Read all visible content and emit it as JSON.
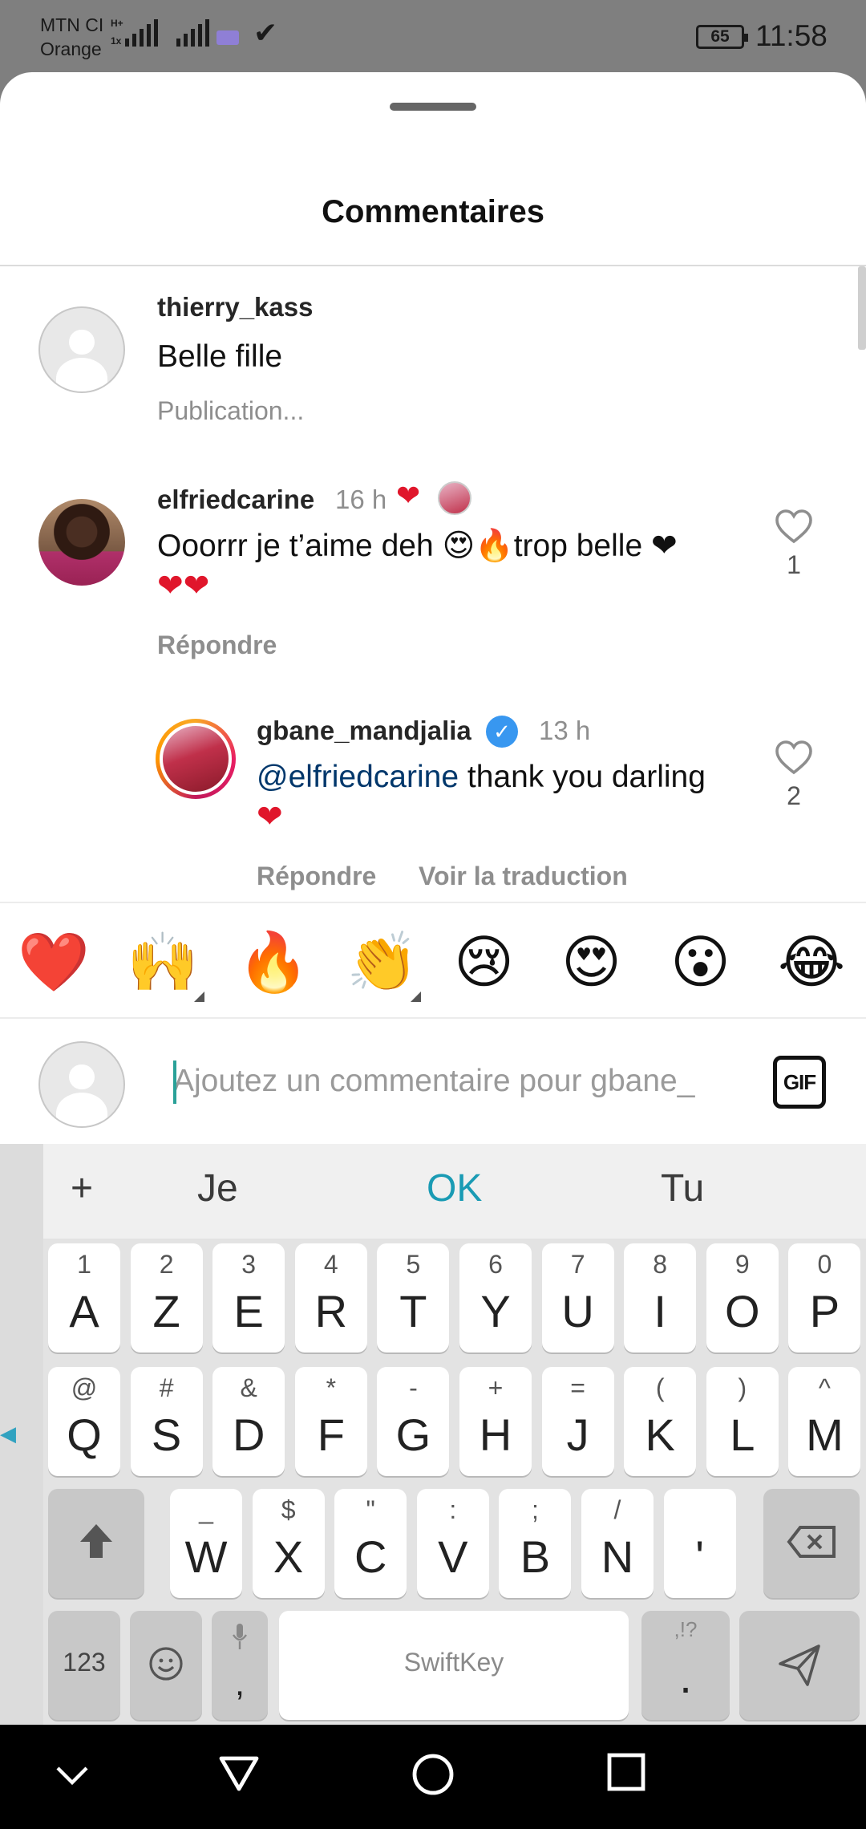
{
  "status_bar": {
    "carrier_line1": "MTN CI",
    "carrier_line2": "Orange",
    "net1": "H+",
    "net2": "1x",
    "battery": "65",
    "time": "11:58"
  },
  "sheet": {
    "title": "Commentaires"
  },
  "comments": [
    {
      "username": "thierry_kass",
      "text": "Belle fille",
      "status": "Publication..."
    },
    {
      "username": "elfriedcarine",
      "time": "16 h",
      "text_line1": "Ooorrr je t’aime deh 😍🔥trop belle ❤",
      "text_line2": "❤❤",
      "reply_label": "Répondre",
      "like_count": "1",
      "liked_by_author_icon": "heart"
    }
  ],
  "reply": {
    "username": "gbane_mandjalia",
    "time": "13 h",
    "mention": "@elfriedcarine",
    "text_rest": " thank you darling",
    "text_line2": "❤",
    "reply_label": "Répondre",
    "translate_label": "Voir la traduction",
    "like_count": "2"
  },
  "emoji_bar": [
    "❤️",
    "🙌",
    "🔥",
    "👏",
    "😢",
    "😍",
    "😮",
    "😂"
  ],
  "composer": {
    "placeholder": "Ajoutez un commentaire pour gbane_",
    "gif_label": "GIF"
  },
  "keyboard": {
    "suggestions": [
      "+",
      "Je",
      "OK",
      "Tu"
    ],
    "row1": [
      {
        "sec": "1",
        "pri": "A"
      },
      {
        "sec": "2",
        "pri": "Z"
      },
      {
        "sec": "3",
        "pri": "E"
      },
      {
        "sec": "4",
        "pri": "R"
      },
      {
        "sec": "5",
        "pri": "T"
      },
      {
        "sec": "6",
        "pri": "Y"
      },
      {
        "sec": "7",
        "pri": "U"
      },
      {
        "sec": "8",
        "pri": "I"
      },
      {
        "sec": "9",
        "pri": "O"
      },
      {
        "sec": "0",
        "pri": "P"
      }
    ],
    "row2": [
      {
        "sec": "@",
        "pri": "Q"
      },
      {
        "sec": "#",
        "pri": "S"
      },
      {
        "sec": "&",
        "pri": "D"
      },
      {
        "sec": "*",
        "pri": "F"
      },
      {
        "sec": "-",
        "pri": "G"
      },
      {
        "sec": "+",
        "pri": "H"
      },
      {
        "sec": "=",
        "pri": "J"
      },
      {
        "sec": "(",
        "pri": "K"
      },
      {
        "sec": ")",
        "pri": "L"
      },
      {
        "sec": "^",
        "pri": "M"
      }
    ],
    "row3": [
      {
        "sec": "_",
        "pri": "W"
      },
      {
        "sec": "$",
        "pri": "X"
      },
      {
        "sec": "\"",
        "pri": "C"
      },
      {
        "sec": ":",
        "pri": "V"
      },
      {
        "sec": ";",
        "pri": "B"
      },
      {
        "sec": "/",
        "pri": "N"
      },
      {
        "sec": "",
        "pri": "'"
      }
    ],
    "numbers_label": "123",
    "comma_label": ",",
    "space_label": "SwiftKey",
    "punct_sec": ",!?",
    "punct_pri": "."
  },
  "colors": {
    "accent": "#1a9bb4",
    "like_red": "#e0162b",
    "mention": "#00376b",
    "verified": "#3897f0"
  }
}
